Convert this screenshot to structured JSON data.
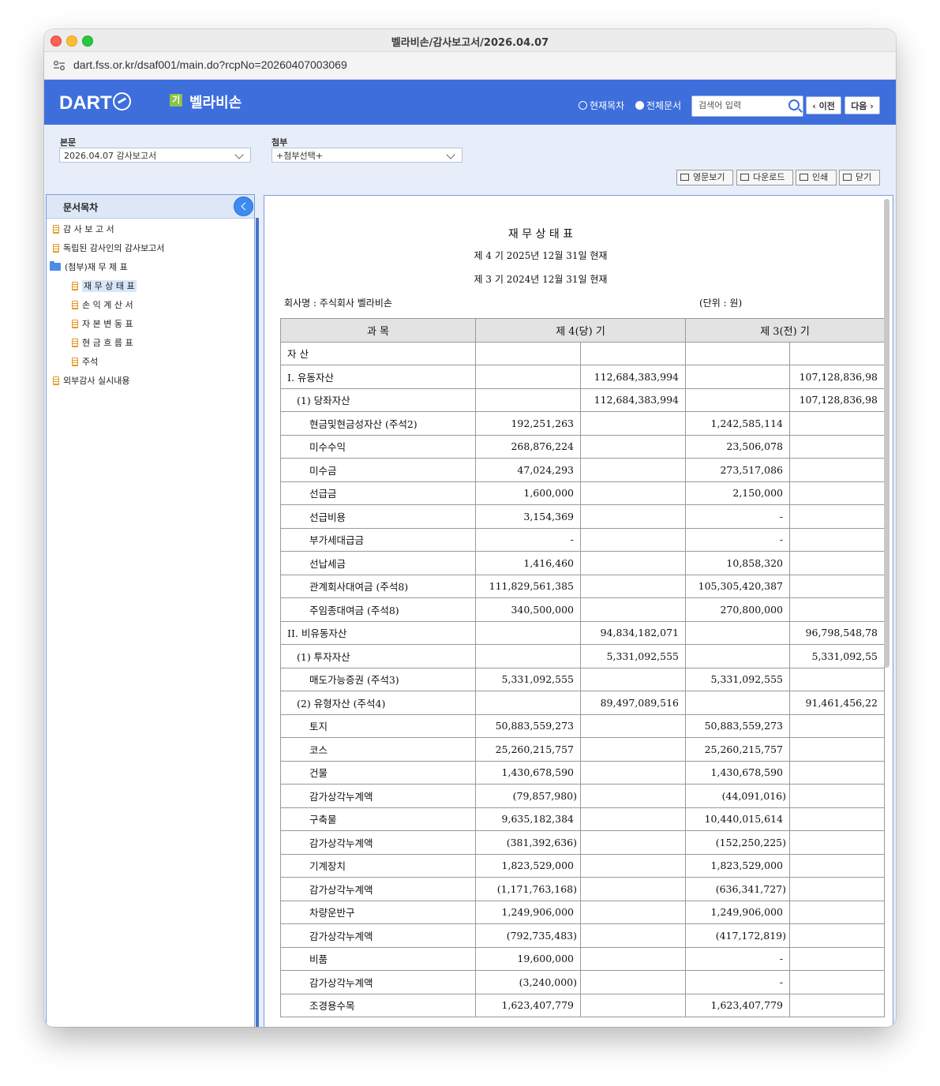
{
  "window": {
    "title": "벨라비손/감사보고서/2026.04.07"
  },
  "browser": {
    "url": "dart.fss.or.kr/dsaf001/main.do?rcpNo=20260407003069"
  },
  "header": {
    "logo": "DART",
    "badge": "기",
    "company": "벨라비손",
    "radio_current": "현재목차",
    "radio_all": "전체문서",
    "search_placeholder": "검색어 입력",
    "prev_label": "이전",
    "next_label": "다음"
  },
  "subbar": {
    "main_label": "본문",
    "main_select": "2026.04.07 감사보고서",
    "attach_label": "첨부",
    "attach_select": "+첨부선택+",
    "tools": [
      "영문보기",
      "다운로드",
      "인쇄",
      "닫기"
    ]
  },
  "toc": {
    "title": "문서목차",
    "items": [
      {
        "label": "감 사 보 고 서",
        "type": "doc"
      },
      {
        "label": "독립된 감사인의 감사보고서",
        "type": "doc"
      },
      {
        "label": "(첨부)재 무 제 표",
        "type": "folder"
      },
      {
        "label": "재 무 상 태 표",
        "type": "doc",
        "selected": true
      },
      {
        "label": "손 익 계 산 서",
        "type": "doc"
      },
      {
        "label": "자 본 변 동 표",
        "type": "doc"
      },
      {
        "label": "현 금 흐 름 표",
        "type": "doc"
      },
      {
        "label": "주석",
        "type": "doc"
      },
      {
        "label": "외부감사 실시내용",
        "type": "doc"
      }
    ]
  },
  "report": {
    "title": "재 무 상 태 표",
    "period_current": "제 4 기 2025년 12월 31일 현재",
    "period_prior": "제 3 기 2024년 12월 31일 현재",
    "company_line": "회사명 : 주식회사 벨라비손",
    "unit": "(단위 : 원)",
    "headers": [
      "과 목",
      "제 4(당) 기",
      "제 3(전) 기"
    ],
    "rows": [
      {
        "name": "자 산",
        "level": 0,
        "c1": "",
        "c2": "",
        "c3": "",
        "c4": ""
      },
      {
        "name": "I. 유동자산",
        "level": 0,
        "c1": "",
        "c2": "112,684,383,994",
        "c3": "",
        "c4": "107,128,836,98"
      },
      {
        "name": "(1) 당좌자산",
        "level": 1,
        "c1": "",
        "c2": "112,684,383,994",
        "c3": "",
        "c4": "107,128,836,98"
      },
      {
        "name": "현금및현금성자산 (주석2)",
        "level": 2,
        "c1": "192,251,263",
        "c2": "",
        "c3": "1,242,585,114",
        "c4": ""
      },
      {
        "name": "미수수익",
        "level": 2,
        "c1": "268,876,224",
        "c2": "",
        "c3": "23,506,078",
        "c4": ""
      },
      {
        "name": "미수금",
        "level": 2,
        "c1": "47,024,293",
        "c2": "",
        "c3": "273,517,086",
        "c4": ""
      },
      {
        "name": "선급금",
        "level": 2,
        "c1": "1,600,000",
        "c2": "",
        "c3": "2,150,000",
        "c4": ""
      },
      {
        "name": "선급비용",
        "level": 2,
        "c1": "3,154,369",
        "c2": "",
        "c3": "-",
        "c4": ""
      },
      {
        "name": "부가세대급금",
        "level": 2,
        "c1": "-",
        "c2": "",
        "c3": "-",
        "c4": ""
      },
      {
        "name": "선납세금",
        "level": 2,
        "c1": "1,416,460",
        "c2": "",
        "c3": "10,858,320",
        "c4": ""
      },
      {
        "name": "관계회사대여금 (주석8)",
        "level": 2,
        "c1": "111,829,561,385",
        "c2": "",
        "c3": "105,305,420,387",
        "c4": ""
      },
      {
        "name": "주임종대여금 (주석8)",
        "level": 2,
        "c1": "340,500,000",
        "c2": "",
        "c3": "270,800,000",
        "c4": ""
      },
      {
        "name": "II. 비유동자산",
        "level": 0,
        "c1": "",
        "c2": "94,834,182,071",
        "c3": "",
        "c4": "96,798,548,78"
      },
      {
        "name": "(1) 투자자산",
        "level": 1,
        "c1": "",
        "c2": "5,331,092,555",
        "c3": "",
        "c4": "5,331,092,55"
      },
      {
        "name": "매도가능증권 (주석3)",
        "level": 2,
        "c1": "5,331,092,555",
        "c2": "",
        "c3": "5,331,092,555",
        "c4": ""
      },
      {
        "name": "(2) 유형자산 (주석4)",
        "level": 1,
        "c1": "",
        "c2": "89,497,089,516",
        "c3": "",
        "c4": "91,461,456,22"
      },
      {
        "name": "토지",
        "level": 2,
        "c1": "50,883,559,273",
        "c2": "",
        "c3": "50,883,559,273",
        "c4": ""
      },
      {
        "name": "코스",
        "level": 2,
        "c1": "25,260,215,757",
        "c2": "",
        "c3": "25,260,215,757",
        "c4": ""
      },
      {
        "name": "건물",
        "level": 2,
        "c1": "1,430,678,590",
        "c2": "",
        "c3": "1,430,678,590",
        "c4": ""
      },
      {
        "name": "감가상각누계액",
        "level": 2,
        "c1": "(79,857,980)",
        "c2": "",
        "c3": "(44,091,016)",
        "c4": ""
      },
      {
        "name": "구축물",
        "level": 2,
        "c1": "9,635,182,384",
        "c2": "",
        "c3": "10,440,015,614",
        "c4": ""
      },
      {
        "name": "감가상각누계액",
        "level": 2,
        "c1": "(381,392,636)",
        "c2": "",
        "c3": "(152,250,225)",
        "c4": ""
      },
      {
        "name": "기계장치",
        "level": 2,
        "c1": "1,823,529,000",
        "c2": "",
        "c3": "1,823,529,000",
        "c4": ""
      },
      {
        "name": "감가상각누계액",
        "level": 2,
        "c1": "(1,171,763,168)",
        "c2": "",
        "c3": "(636,341,727)",
        "c4": ""
      },
      {
        "name": "차량운반구",
        "level": 2,
        "c1": "1,249,906,000",
        "c2": "",
        "c3": "1,249,906,000",
        "c4": ""
      },
      {
        "name": "감가상각누계액",
        "level": 2,
        "c1": "(792,735,483)",
        "c2": "",
        "c3": "(417,172,819)",
        "c4": ""
      },
      {
        "name": "비품",
        "level": 2,
        "c1": "19,600,000",
        "c2": "",
        "c3": "-",
        "c4": ""
      },
      {
        "name": "감가상각누계액",
        "level": 2,
        "c1": "(3,240,000)",
        "c2": "",
        "c3": "-",
        "c4": ""
      },
      {
        "name": "조경용수목",
        "level": 2,
        "c1": "1,623,407,779",
        "c2": "",
        "c3": "1,623,407,779",
        "c4": ""
      }
    ]
  }
}
